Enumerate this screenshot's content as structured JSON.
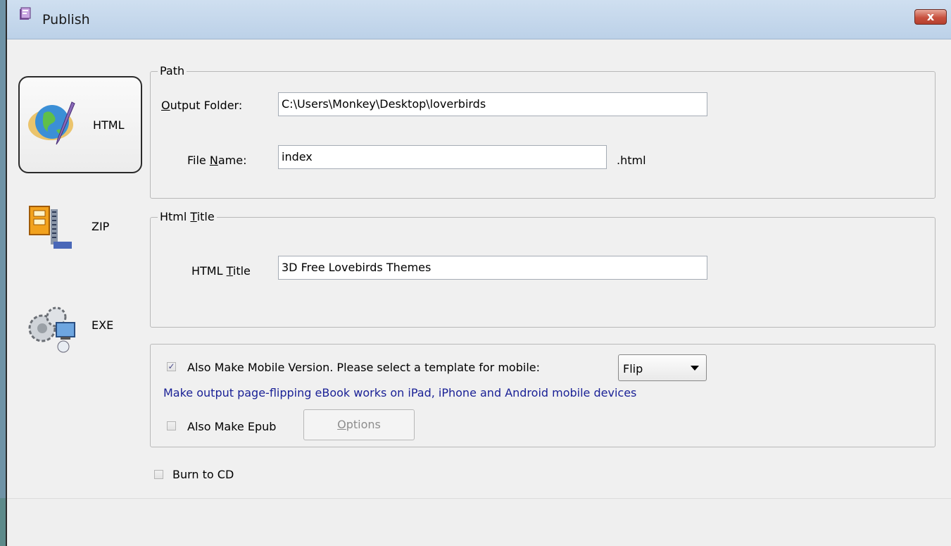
{
  "window": {
    "title": "Publish",
    "close_label": "x"
  },
  "sidebar": {
    "items": [
      {
        "label": "HTML",
        "icon": "globe-pen-icon",
        "active": true
      },
      {
        "label": "ZIP",
        "icon": "zip-archive-icon",
        "active": false
      },
      {
        "label": "EXE",
        "icon": "gears-computer-icon",
        "active": false
      }
    ]
  },
  "path_group": {
    "legend": "Path",
    "output_folder_label_pre": "",
    "output_folder_label_u": "O",
    "output_folder_label_post": "utput Folder:",
    "output_folder_value": "C:\\Users\\Monkey\\Desktop\\loverbirds",
    "file_name_label_pre": "File ",
    "file_name_label_u": "N",
    "file_name_label_post": "ame:",
    "file_name_value": "index",
    "file_ext": ".html"
  },
  "title_group": {
    "legend_pre": "Html ",
    "legend_u": "T",
    "legend_post": "itle",
    "label_pre": "HTML ",
    "label_u": "T",
    "label_post": "itle",
    "value": "3D Free Lovebirds Themes"
  },
  "mobile_group": {
    "mobile_checked": true,
    "mobile_label": "Also Make Mobile Version. Please select a template for mobile:",
    "template_selected": "Flip",
    "note": "Make output page-flipping eBook works on iPad, iPhone and Android mobile devices",
    "epub_checked": false,
    "epub_label": "Also Make Epub",
    "options_label_u": "O",
    "options_label_post": "ptions"
  },
  "burn": {
    "checked": false,
    "label": "Burn to CD"
  }
}
